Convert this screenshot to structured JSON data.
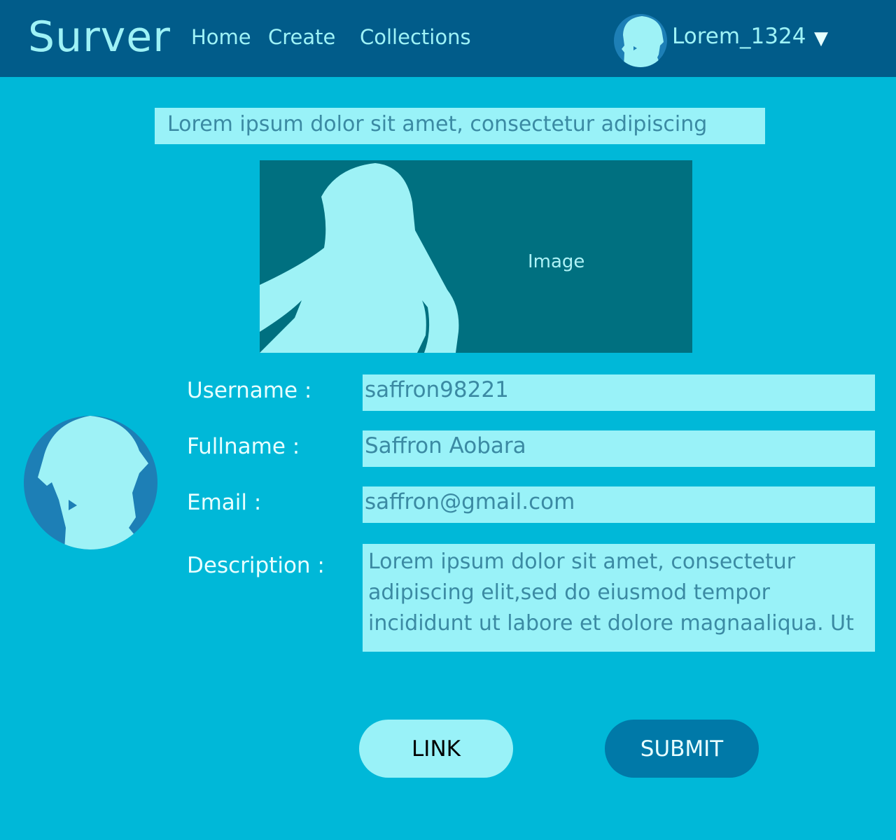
{
  "navbar": {
    "logo": "Surver",
    "links": [
      "Home",
      "Create",
      "Collections"
    ],
    "username": "Lorem_1324",
    "caret": "▼"
  },
  "page": {
    "title": "Lorem ipsum dolor sit amet, consectetur adipiscing",
    "image_label": "Image"
  },
  "form": {
    "username_label": "Username :",
    "username_value": "saffron98221",
    "fullname_label": "Fullname :",
    "fullname_value": "Saffron Aobara",
    "email_label": "Email :",
    "email_value": "saffron@gmail.com",
    "description_label": "Description :",
    "description_value": "Lorem ipsum dolor sit amet, consectetur adipiscing elit,sed do eiusmod tempor incididunt ut labore et dolore magnaaliqua. Ut"
  },
  "buttons": {
    "link_label": "LINK",
    "submit_label": "SUBMIT"
  },
  "colors": {
    "background": "#00b8d8",
    "navbar": "#015c8a",
    "input_fill": "#99f2f8",
    "image_fill": "#007080",
    "avatar_ring": "#1d7fb6",
    "submit_button": "#0079a8"
  },
  "icons": {
    "user_avatar": "person-silhouette-icon",
    "cover_image": "long-hair-silhouette-image",
    "caret": "chevron-down-icon"
  }
}
